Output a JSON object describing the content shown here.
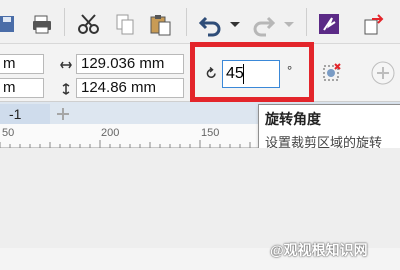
{
  "size": {
    "width_value": "129.036 mm",
    "height_value": "124.86 mm",
    "left_width_fragment": "m",
    "left_height_fragment": "m"
  },
  "rotation": {
    "value": "45",
    "degree_symbol": "°"
  },
  "page_tab": {
    "label": "-1"
  },
  "ruler": {
    "labels": [
      "50",
      "200",
      "150"
    ]
  },
  "tooltip": {
    "title": "旋转角度",
    "description": "设置裁剪区域的旋转"
  },
  "watermark": "@观视根知识网",
  "colors": {
    "highlight": "#e3252b",
    "active_input_border": "#3a88d8",
    "icon_purple": "#5b2a86"
  }
}
